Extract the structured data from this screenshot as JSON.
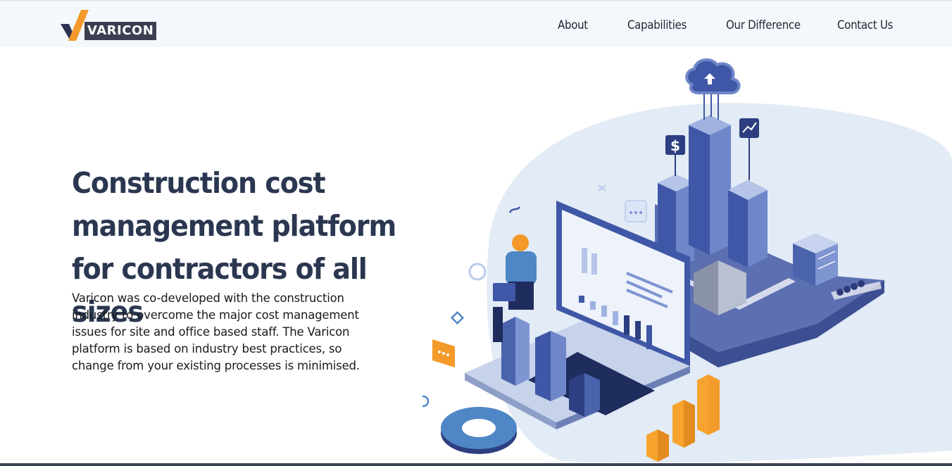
{
  "brand": {
    "logo_text": "VARICON"
  },
  "nav": {
    "items": [
      {
        "label": "About"
      },
      {
        "label": "Capabilities"
      },
      {
        "label": "Our Difference"
      },
      {
        "label": "Contact Us"
      }
    ]
  },
  "hero": {
    "headline": "Construction cost management platform for contractors of all sizes",
    "description": "Varicon was co-developed with the construction industry to overcome the major cost management issues for site and office based staff. The Varicon platform is based on industry best practices, so change from your existing processes is minimised."
  },
  "illustration": {
    "dollar_badge": "$",
    "colors": {
      "primary": "#3b5ba5",
      "dark": "#2d3f80",
      "light": "#dfe8f5",
      "accent": "#f39a2a"
    }
  }
}
